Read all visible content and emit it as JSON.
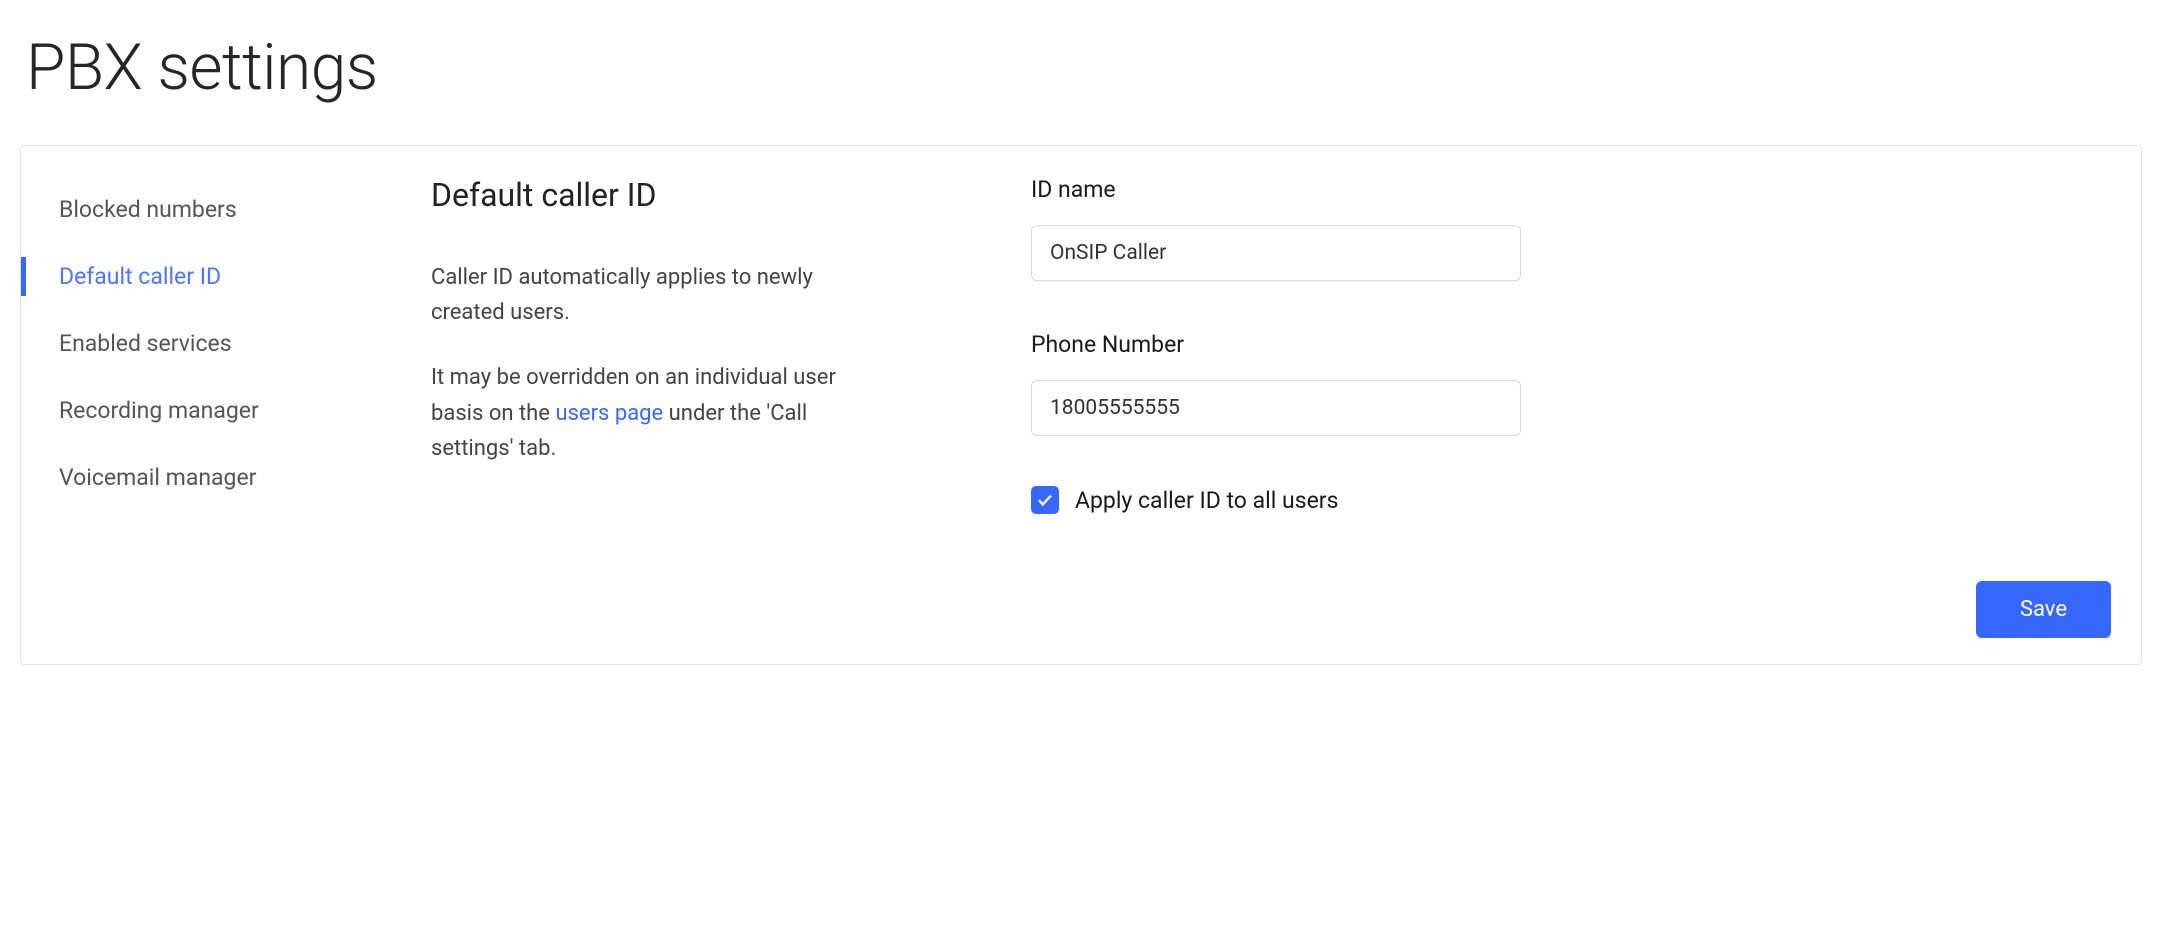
{
  "page": {
    "title": "PBX settings"
  },
  "sidebar": {
    "items": [
      {
        "label": "Blocked numbers",
        "active": false
      },
      {
        "label": "Default caller ID",
        "active": true
      },
      {
        "label": "Enabled services",
        "active": false
      },
      {
        "label": "Recording manager",
        "active": false
      },
      {
        "label": "Voicemail manager",
        "active": false
      }
    ]
  },
  "section": {
    "heading": "Default caller ID",
    "desc_line1": "Caller ID automatically applies to newly created users.",
    "desc_line2_pre": "It may be overridden on an individual user basis on the ",
    "desc_line2_link": "users page",
    "desc_line2_post": " under the 'Call settings' tab."
  },
  "form": {
    "id_name": {
      "label": "ID name",
      "value": "OnSIP Caller"
    },
    "phone_number": {
      "label": "Phone Number",
      "value": "18005555555"
    },
    "apply_all": {
      "label": "Apply caller ID to all users",
      "checked": true
    },
    "save_label": "Save"
  }
}
